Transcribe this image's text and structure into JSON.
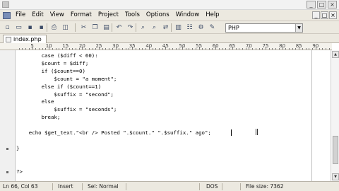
{
  "menu": {
    "items": [
      "File",
      "Edit",
      "View",
      "Format",
      "Project",
      "Tools",
      "Options",
      "Window",
      "Help"
    ]
  },
  "toolbar": {
    "language": "PHP",
    "buttons": [
      {
        "name": "new-file-icon",
        "glyph": "▫"
      },
      {
        "name": "open-file-icon",
        "glyph": "▭"
      },
      {
        "name": "save-icon",
        "glyph": "▪"
      },
      {
        "name": "save-all-icon",
        "glyph": "▪"
      },
      {
        "name": "print-icon",
        "glyph": "⎙"
      },
      {
        "name": "preview-icon",
        "glyph": "◫"
      },
      {
        "name": "cut-icon",
        "glyph": "✂"
      },
      {
        "name": "copy-icon",
        "glyph": "❐"
      },
      {
        "name": "paste-icon",
        "glyph": "▤"
      },
      {
        "name": "undo-icon",
        "glyph": "↶"
      },
      {
        "name": "redo-icon",
        "glyph": "↷"
      },
      {
        "name": "find-icon",
        "glyph": "⌕"
      },
      {
        "name": "find-next-icon",
        "glyph": "⌕"
      },
      {
        "name": "replace-icon",
        "glyph": "⇄"
      },
      {
        "name": "bookmark-icon",
        "glyph": "▥"
      },
      {
        "name": "toggle-icon",
        "glyph": "☷"
      },
      {
        "name": "options-icon",
        "glyph": "⚙"
      },
      {
        "name": "tool-icon",
        "glyph": "✎"
      },
      {
        "name": "macro-icon",
        "glyph": "⚙"
      },
      {
        "name": "run-icon",
        "glyph": "⚙"
      },
      {
        "name": "help-icon",
        "glyph": "⚙"
      }
    ]
  },
  "tab": {
    "label": "index.php"
  },
  "ruler": {
    "labels": [
      "5",
      "10",
      "15",
      "20",
      "25",
      "30",
      "35",
      "40",
      "45",
      "50",
      "55",
      "60",
      "65",
      "70",
      "75",
      "80",
      "85",
      "90"
    ]
  },
  "editor": {
    "lines": [
      "        case ($diff < 60):",
      "        $count = $diff;",
      "        if ($count==0)",
      "            $count = \"a moment\";",
      "        else if ($count==1)",
      "            $suffix = \"second\";",
      "        else",
      "            $suffix = \"seconds\";",
      "        break;",
      "",
      "    echo $get_text.\"<br /> Posted \".$count.\" \".$suffix.\" ago\";",
      "",
      "}",
      "",
      "",
      "?>"
    ]
  },
  "status": {
    "position": "Ln 66, Col 63",
    "mode": "Insert",
    "selection": "Sel: Normal",
    "encoding": "DOS",
    "file_size": "File size: 7362"
  }
}
